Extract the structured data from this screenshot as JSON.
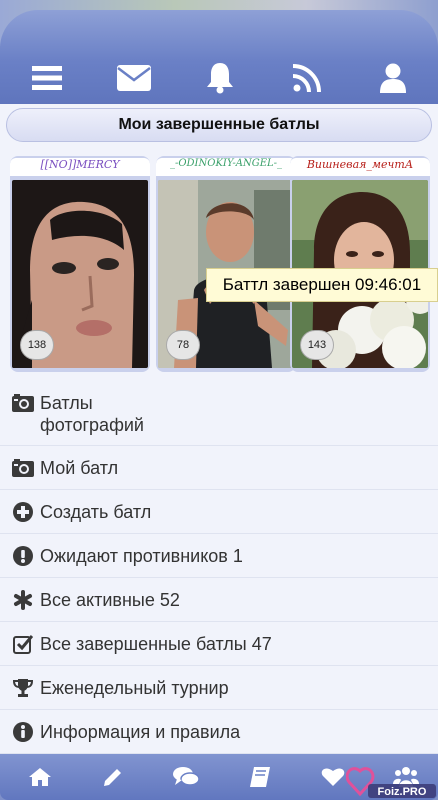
{
  "header": {
    "icons": [
      "menu-icon",
      "envelope-icon",
      "bell-icon",
      "rss-icon",
      "user-icon"
    ]
  },
  "page_title": "Мои завершенные батлы",
  "battle": {
    "participants": [
      {
        "name": "[[NO]]MERCY",
        "score": "138",
        "name_color": "#7a4fc0"
      },
      {
        "name": "_-ODINOKIY-ANGEL-_",
        "score": "78",
        "name_color": "#3aa06a"
      },
      {
        "name": "Вишневая_мечтА",
        "score": "143",
        "name_color": "#b8221c"
      }
    ],
    "status": "Баттл завершен 09:46:01"
  },
  "menu": [
    {
      "icon": "camera-icon",
      "label": "Батлы фотографий"
    },
    {
      "icon": "camera-icon",
      "label": "Мой батл"
    },
    {
      "icon": "plus-circle-icon",
      "label": "Создать батл"
    },
    {
      "icon": "exclamation-circle-icon",
      "label": "Ожидают противников 1"
    },
    {
      "icon": "asterisk-icon",
      "label": "Все активные 52"
    },
    {
      "icon": "check-square-icon",
      "label": "Все завершенные батлы 47"
    },
    {
      "icon": "trophy-icon",
      "label": "Еженедельный турнир"
    },
    {
      "icon": "info-circle-icon",
      "label": "Информация и правила"
    }
  ],
  "footer": {
    "icons": [
      "home-icon",
      "pencil-icon",
      "comments-icon",
      "book-icon",
      "heart-icon",
      "users-icon"
    ]
  },
  "watermark": "Foiz.PRO",
  "colors": {
    "accent": "#6a80c6",
    "menu_text": "#333333",
    "icon": "#3a3a3a"
  }
}
